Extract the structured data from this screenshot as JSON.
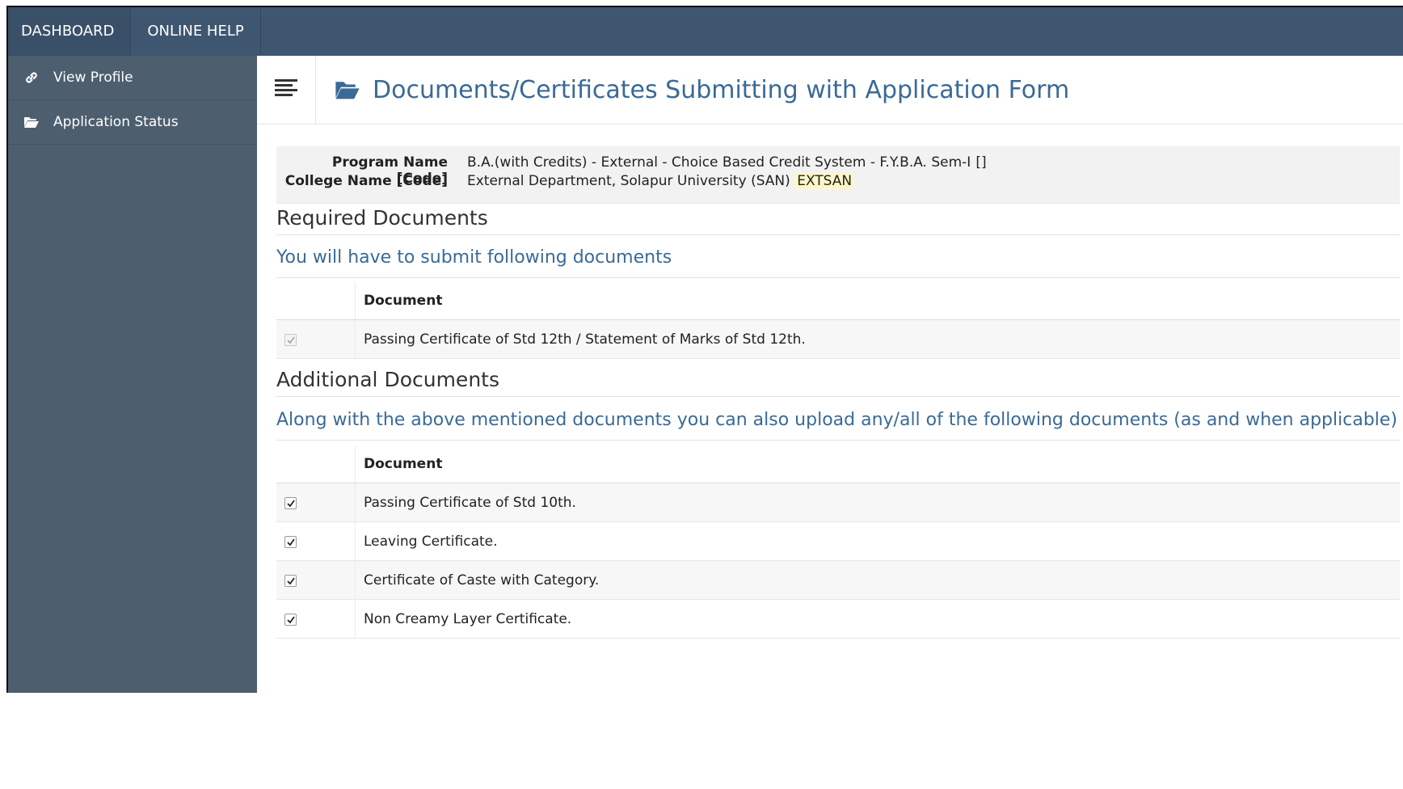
{
  "topbar": {
    "tabs": [
      "DASHBOARD",
      "ONLINE HELP"
    ]
  },
  "sidebar": {
    "items": [
      {
        "label": "View Profile",
        "icon": "link-icon"
      },
      {
        "label": "Application Status",
        "icon": "folder-open-icon"
      }
    ]
  },
  "page": {
    "title": "Documents/Certificates Submitting with Application Form"
  },
  "info": {
    "program_label": "Program Name [Code]",
    "program_value": "B.A.(with Credits) - External - Choice Based Credit System - F.Y.B.A. Sem-I",
    "program_code": "[]",
    "college_label": "College Name [Code]",
    "college_value": "External Department, Solapur University (SAN)",
    "college_code": "EXTSAN"
  },
  "required": {
    "title": "Required Documents",
    "subtitle": "You will have to submit following documents",
    "column": "Document",
    "rows": [
      "Passing Certificate of Std 12th / Statement of Marks of Std 12th."
    ]
  },
  "additional": {
    "title": "Additional Documents",
    "subtitle": "Along with the above mentioned documents you can also upload any/all of the following documents (as and when applicable)",
    "column": "Document",
    "rows": [
      "Passing Certificate of Std 10th.",
      "Leaving Certificate.",
      "Certificate of Caste with Category.",
      "Non Creamy Layer Certificate."
    ]
  },
  "colors": {
    "topbar": "#3f5670",
    "sidebar": "#4d5e6f",
    "accent": "#3a6a96"
  }
}
